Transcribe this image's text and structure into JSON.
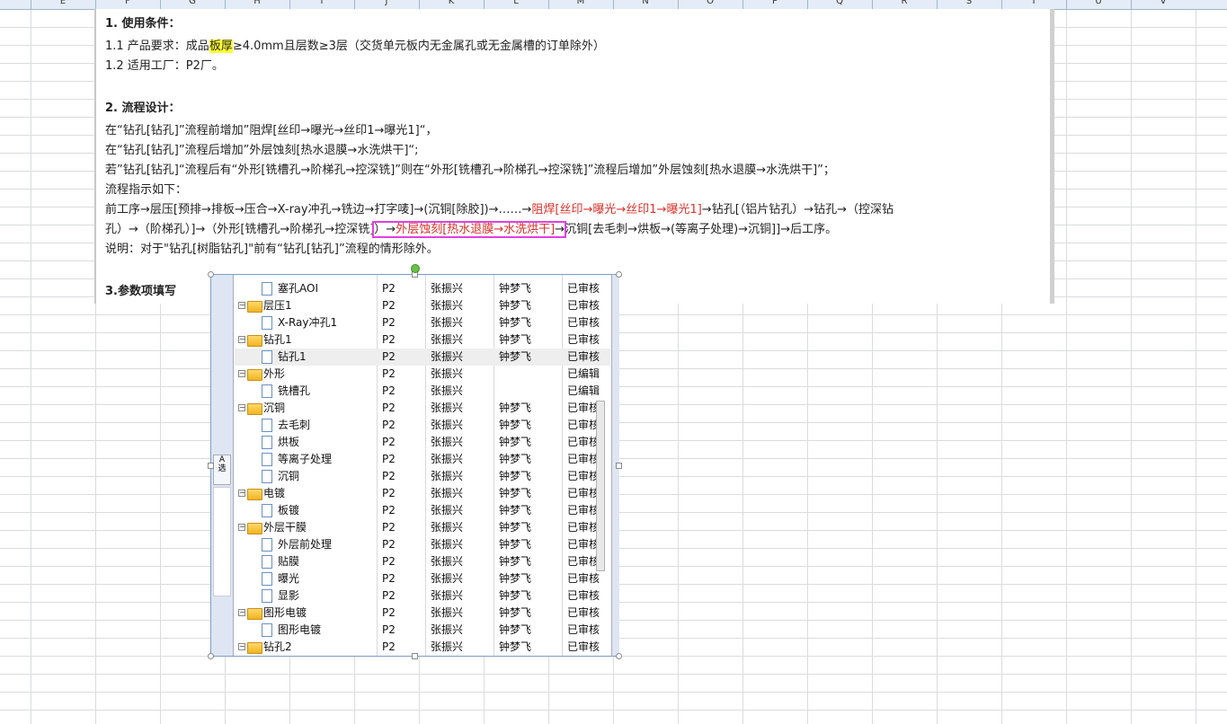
{
  "columns": [
    "E",
    "F",
    "G",
    "H",
    "I",
    "J",
    "K",
    "L",
    "M",
    "N",
    "O",
    "P",
    "Q",
    "R",
    "S",
    "T",
    "U",
    "V"
  ],
  "doc": {
    "s1_title": "1. 使用条件：",
    "s1_line1_pre": "1.1  产品要求：成品",
    "s1_line1_hl": "板厚",
    "s1_line1_post": "≥4.0mm且层数≥3层（交货单元板内无金属孔或无金属槽的订单除外）",
    "s1_line2": "1.2  适用工厂：P2厂。",
    "s2_title": "2. 流程设计：",
    "s2_line1": "在“钻孔[钻孔]”流程前增加”阻焊[丝印→曝光→丝印1→曝光1]“，",
    "s2_line2": "在“钻孔[钻孔]”流程后增加”外层蚀刻[热水退膜→水洗烘干]“;",
    "s2_line3": "若”钻孔[钻孔]“流程后有“外形[铣槽孔→阶梯孔→控深铣]”则在“外形[铣槽孔→阶梯孔→控深铣]”流程后增加”外层蚀刻[热水退膜→水洗烘干]”；",
    "s2_line4": "流程指示如下：",
    "s2_line5_a": "前工序→层压[预排→排板→压合→X-ray冲孔→铣边→打字唛]→(沉铜[除胶])→……→",
    "s2_line5_red": "阻焊[丝印→曝光→丝印1→曝光1]",
    "s2_line5_b": "→钻孔[（铝片钻孔）→钻孔→（控深钻",
    "s2_line6_a": "孔）→（阶梯孔）]→（外形[铣槽孔→阶梯孔→控深铣]",
    "s2_line6_box_a": "）→",
    "s2_line6_box_red": "外层蚀刻[热水退膜→水洗烘干]",
    "s2_line6_box_b": "→",
    "s2_line6_c": "沉铜[去毛刺→烘板→(等离子处理)→沉铜]]→后工序。",
    "s2_line7": "说明：对于\"钻孔[树脂钻孔]\"前有“钻孔[钻孔]”流程的情形除外。",
    "s3_title": "3.参数项填写"
  },
  "left_panel_text": "A\n选",
  "tree_rows": [
    {
      "name": "塞孔AOI",
      "level": 1,
      "type": "file",
      "factory": "P2",
      "p1": "张振兴",
      "p2": "钟梦飞",
      "status": "已审核"
    },
    {
      "name": "层压1",
      "level": 0,
      "type": "folder",
      "factory": "P2",
      "p1": "张振兴",
      "p2": "钟梦飞",
      "status": "已审核"
    },
    {
      "name": "X-Ray冲孔1",
      "level": 1,
      "type": "file",
      "factory": "P2",
      "p1": "张振兴",
      "p2": "钟梦飞",
      "status": "已审核"
    },
    {
      "name": "钻孔1",
      "level": 0,
      "type": "folder",
      "factory": "P2",
      "p1": "张振兴",
      "p2": "钟梦飞",
      "status": "已审核"
    },
    {
      "name": "钻孔1",
      "level": 1,
      "type": "file",
      "factory": "P2",
      "p1": "张振兴",
      "p2": "钟梦飞",
      "status": "已审核",
      "selected": true
    },
    {
      "name": "外形",
      "level": 0,
      "type": "folder",
      "factory": "P2",
      "p1": "张振兴",
      "p2": "",
      "status": "已编辑"
    },
    {
      "name": "铣槽孔",
      "level": 1,
      "type": "file",
      "factory": "P2",
      "p1": "张振兴",
      "p2": "",
      "status": "已编辑"
    },
    {
      "name": "沉铜",
      "level": 0,
      "type": "folder",
      "factory": "P2",
      "p1": "张振兴",
      "p2": "钟梦飞",
      "status": "已审核"
    },
    {
      "name": "去毛刺",
      "level": 1,
      "type": "file",
      "factory": "P2",
      "p1": "张振兴",
      "p2": "钟梦飞",
      "status": "已审核"
    },
    {
      "name": "烘板",
      "level": 1,
      "type": "file",
      "factory": "P2",
      "p1": "张振兴",
      "p2": "钟梦飞",
      "status": "已审核"
    },
    {
      "name": "等离子处理",
      "level": 1,
      "type": "file",
      "factory": "P2",
      "p1": "张振兴",
      "p2": "钟梦飞",
      "status": "已审核"
    },
    {
      "name": "沉铜",
      "level": 1,
      "type": "file",
      "factory": "P2",
      "p1": "张振兴",
      "p2": "钟梦飞",
      "status": "已审核"
    },
    {
      "name": "电镀",
      "level": 0,
      "type": "folder",
      "factory": "P2",
      "p1": "张振兴",
      "p2": "钟梦飞",
      "status": "已审核"
    },
    {
      "name": "板镀",
      "level": 1,
      "type": "file",
      "factory": "P2",
      "p1": "张振兴",
      "p2": "钟梦飞",
      "status": "已审核"
    },
    {
      "name": "外层干膜",
      "level": 0,
      "type": "folder",
      "factory": "P2",
      "p1": "张振兴",
      "p2": "钟梦飞",
      "status": "已审核"
    },
    {
      "name": "外层前处理",
      "level": 1,
      "type": "file",
      "factory": "P2",
      "p1": "张振兴",
      "p2": "钟梦飞",
      "status": "已审核"
    },
    {
      "name": "贴膜",
      "level": 1,
      "type": "file",
      "factory": "P2",
      "p1": "张振兴",
      "p2": "钟梦飞",
      "status": "已审核"
    },
    {
      "name": "曝光",
      "level": 1,
      "type": "file",
      "factory": "P2",
      "p1": "张振兴",
      "p2": "钟梦飞",
      "status": "已审核"
    },
    {
      "name": "显影",
      "level": 1,
      "type": "file",
      "factory": "P2",
      "p1": "张振兴",
      "p2": "钟梦飞",
      "status": "已审核"
    },
    {
      "name": "图形电镀",
      "level": 0,
      "type": "folder",
      "factory": "P2",
      "p1": "张振兴",
      "p2": "钟梦飞",
      "status": "已审核"
    },
    {
      "name": "图形电镀",
      "level": 1,
      "type": "file",
      "factory": "P2",
      "p1": "张振兴",
      "p2": "钟梦飞",
      "status": "已审核"
    },
    {
      "name": "钻孔2",
      "level": 0,
      "type": "folder",
      "factory": "P2",
      "p1": "张振兴",
      "p2": "钟梦飞",
      "status": "已审核"
    }
  ]
}
